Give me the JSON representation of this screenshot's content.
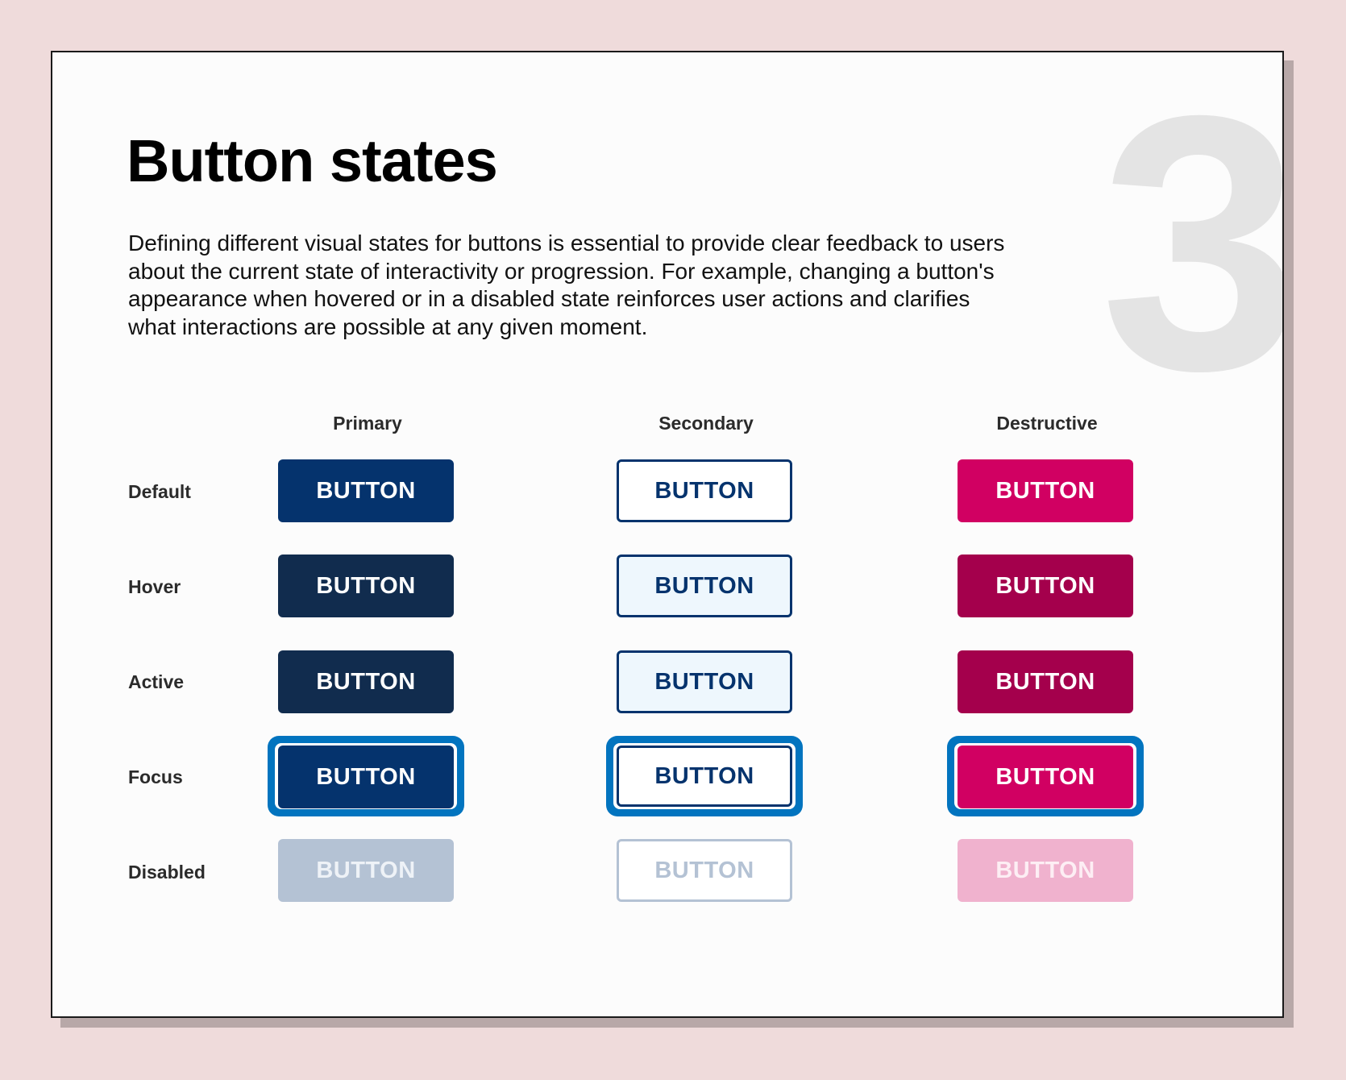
{
  "page": {
    "title": "Button states",
    "section_number": "3",
    "description": "Defining different visual states for buttons is essential to provide clear feedback to users about the current state of interactivity or progression. For example, changing a button's appearance when hovered or in a disabled state reinforces user actions and clarifies what interactions are possible at any given moment."
  },
  "colors": {
    "page_background": "#efdbdb",
    "card_background": "#fcfcfc",
    "card_shadow": "#b8a8a8",
    "focus_ring": "#0274bf",
    "primary_default": "#05336d",
    "primary_hover": "#112c4e",
    "primary_active": "#112c4e",
    "primary_disabled": "#b4c2d4",
    "secondary_border": "#05336d",
    "secondary_hover_bg": "#eef7fd",
    "secondary_disabled": "#b4c2d4",
    "destructive_default": "#d10062",
    "destructive_hover": "#a4004c",
    "destructive_active": "#a4004c",
    "destructive_disabled": "#f0b2ce"
  },
  "grid": {
    "columns": [
      {
        "key": "primary",
        "label": "Primary"
      },
      {
        "key": "secondary",
        "label": "Secondary"
      },
      {
        "key": "destructive",
        "label": "Destructive"
      }
    ],
    "rows": [
      {
        "key": "default",
        "label": "Default"
      },
      {
        "key": "hover",
        "label": "Hover"
      },
      {
        "key": "active",
        "label": "Active"
      },
      {
        "key": "focus",
        "label": "Focus"
      },
      {
        "key": "disabled",
        "label": "Disabled"
      }
    ],
    "button_label": "BUTTON",
    "buttons": {
      "primary": {
        "default": {
          "label": "BUTTON",
          "bg": "#05336d",
          "fg": "#ffffff",
          "border": "none"
        },
        "hover": {
          "label": "BUTTON",
          "bg": "#112c4e",
          "fg": "#ffffff",
          "border": "none"
        },
        "active": {
          "label": "BUTTON",
          "bg": "#112c4e",
          "fg": "#ffffff",
          "border": "none"
        },
        "focus": {
          "label": "BUTTON",
          "bg": "#05336d",
          "fg": "#ffffff",
          "border": "none"
        },
        "disabled": {
          "label": "BUTTON",
          "bg": "#b4c2d4",
          "fg": "#eef2f7",
          "border": "none"
        }
      },
      "secondary": {
        "default": {
          "label": "BUTTON",
          "bg": "#ffffff",
          "fg": "#05336d",
          "border": "#05336d"
        },
        "hover": {
          "label": "BUTTON",
          "bg": "#eef7fd",
          "fg": "#05336d",
          "border": "#05336d"
        },
        "active": {
          "label": "BUTTON",
          "bg": "#eef7fd",
          "fg": "#05336d",
          "border": "#05336d"
        },
        "focus": {
          "label": "BUTTON",
          "bg": "#ffffff",
          "fg": "#05336d",
          "border": "#05336d"
        },
        "disabled": {
          "label": "BUTTON",
          "bg": "#ffffff",
          "fg": "#b4c2d4",
          "border": "#b4c2d4"
        }
      },
      "destructive": {
        "default": {
          "label": "BUTTON",
          "bg": "#d10062",
          "fg": "#ffffff",
          "border": "none"
        },
        "hover": {
          "label": "BUTTON",
          "bg": "#a4004c",
          "fg": "#ffffff",
          "border": "none"
        },
        "active": {
          "label": "BUTTON",
          "bg": "#a4004c",
          "fg": "#ffffff",
          "border": "none"
        },
        "focus": {
          "label": "BUTTON",
          "bg": "#d10062",
          "fg": "#ffffff",
          "border": "none"
        },
        "disabled": {
          "label": "BUTTON",
          "bg": "#f0b2ce",
          "fg": "#fdeef4",
          "border": "none"
        }
      }
    }
  }
}
